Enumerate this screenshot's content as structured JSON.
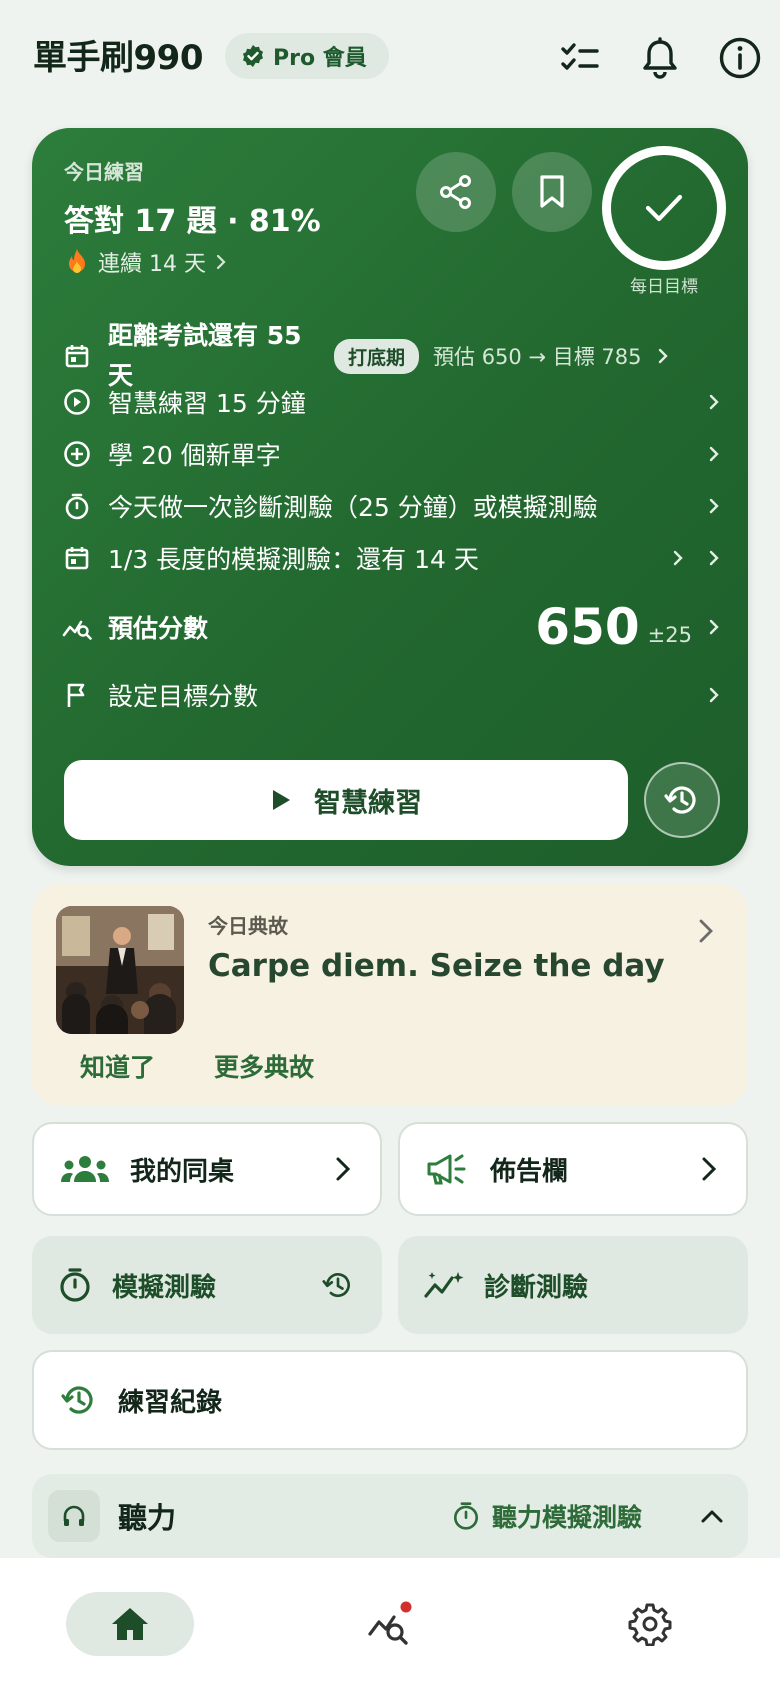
{
  "header": {
    "app_title": "單手刷990",
    "badge_label": "Pro 會員",
    "icons": [
      "checklist-icon",
      "bell-icon",
      "info-icon"
    ]
  },
  "today": {
    "small_label": "今日練習",
    "headline": "答對 17 題 · 81%",
    "streak": "連續 14 天",
    "goal_label": "每日目標",
    "exam_countdown": "距離考試還有 55 天",
    "phase": "打底期",
    "projection": "預估 650 → 目標 785",
    "tasks": [
      {
        "label": "智慧練習 15 分鐘",
        "icon": "play-circle-icon"
      },
      {
        "label": "學 20 個新單字",
        "icon": "plus-circle-icon"
      },
      {
        "label": "今天做一次診斷測驗（25 分鐘）或模擬測驗",
        "icon": "timer-icon"
      },
      {
        "label": "1/3 長度的模擬測驗：還有 14 天",
        "icon": "calendar-icon"
      }
    ],
    "score_label": "預估分數",
    "score_value": "650",
    "score_margin": "±25",
    "set_target": "設定目標分數",
    "primary_button": "智慧練習"
  },
  "quote": {
    "small_label": "今日典故",
    "text": "Carpe diem. Seize the day",
    "ack_button": "知道了",
    "more_button": "更多典故"
  },
  "tiles": {
    "deskmate": "我的同桌",
    "bulletin": "佈告欄",
    "mock_test": "模擬測驗",
    "diagnostic": "診斷測驗",
    "history": "練習紀錄"
  },
  "listening": {
    "title": "聽力",
    "mock_label": "聽力模擬測驗"
  },
  "colors": {
    "brand_green": "#2d7d3c",
    "accent_dark": "#1e4d2a",
    "notification_dot": "#d32f2f"
  }
}
